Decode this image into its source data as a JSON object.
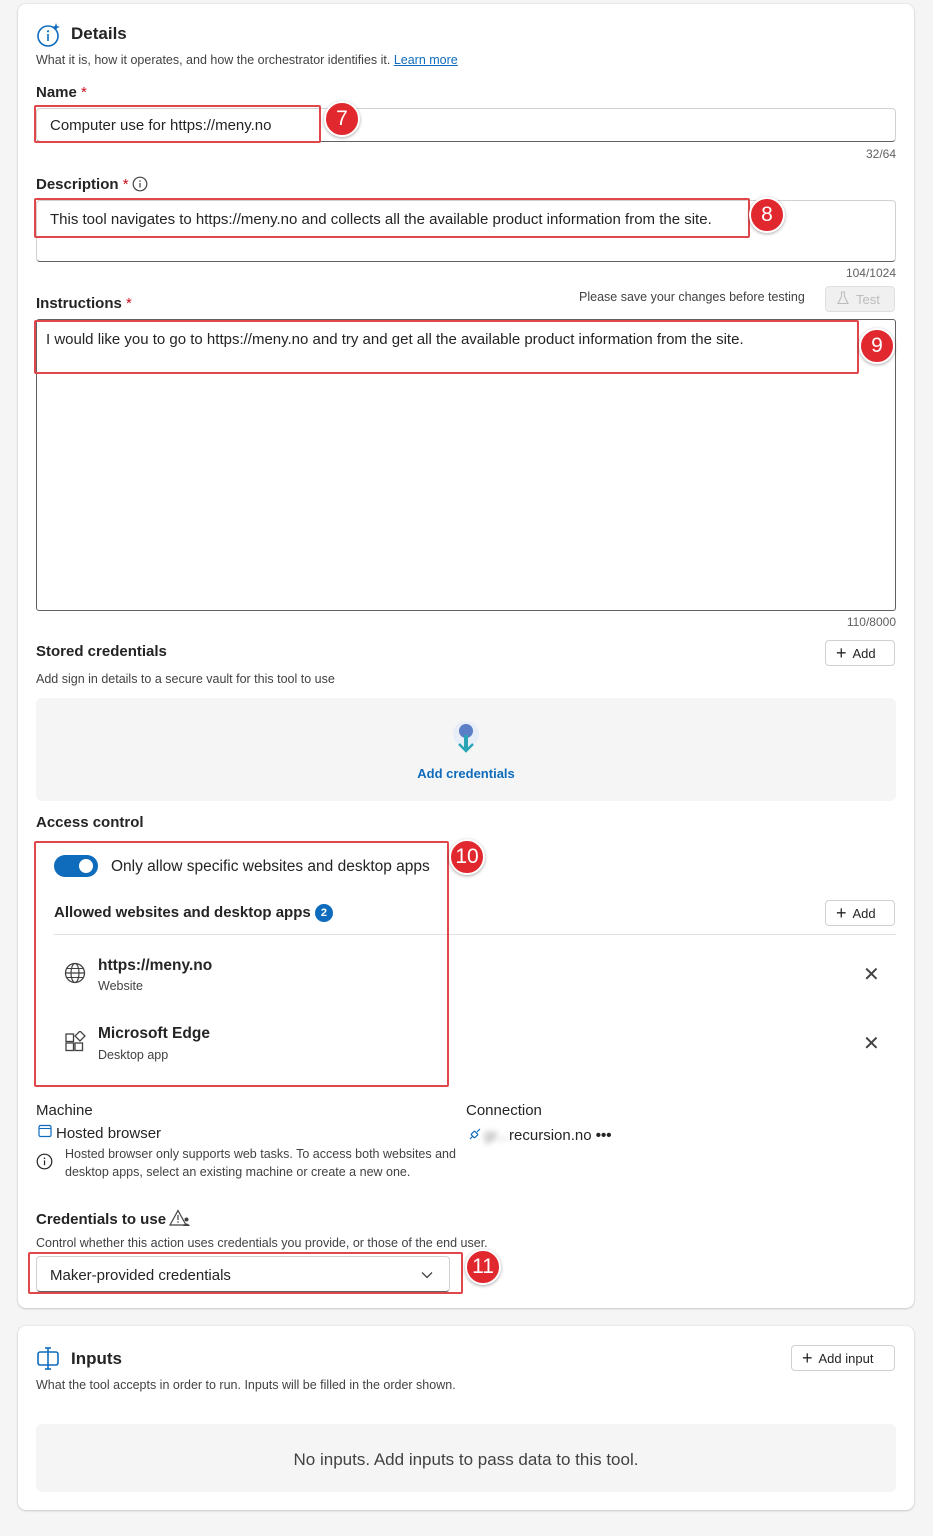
{
  "details": {
    "title": "Details",
    "subtitle": "What it is, how it operates, and how the orchestrator identifies it.",
    "learn_more": "Learn more",
    "name": {
      "label": "Name",
      "required": "*",
      "value": "Computer use for https://meny.no",
      "counter": "32/64"
    },
    "description": {
      "label": "Description",
      "required": "*",
      "value": "This tool navigates to https://meny.no and collects all the available product information from the site.",
      "counter": "104/1024"
    },
    "instructions": {
      "label": "Instructions",
      "required": "*",
      "save_notice": "Please save your changes before testing",
      "test_label": "Test",
      "value": "I would like you to go to https://meny.no and try and get all the available product information from the site.",
      "counter": "110/8000"
    },
    "stored_credentials": {
      "label": "Stored credentials",
      "description": "Add sign in details to a secure vault for this tool to use",
      "add_label": "Add",
      "empty_action": "Add credentials"
    },
    "access_control": {
      "label": "Access control",
      "toggle_label": "Only allow specific websites and desktop apps",
      "toggle_on": true,
      "allowed_title": "Allowed websites and desktop apps",
      "allowed_count": "2",
      "add_label": "Add",
      "items": [
        {
          "name": "https://meny.no",
          "type": "Website",
          "icon": "globe-icon"
        },
        {
          "name": "Microsoft Edge",
          "type": "Desktop app",
          "icon": "app-grid-icon"
        }
      ]
    },
    "machine": {
      "label": "Machine",
      "value": "Hosted browser",
      "note": "Hosted browser only supports web tasks. To access both websites and desktop apps, select an existing machine or create a new one."
    },
    "connection": {
      "label": "Connection",
      "value_hidden": "gr...",
      "value_suffix": "recursion.no",
      "more": "•••"
    },
    "credentials_to_use": {
      "label": "Credentials to use",
      "description": "Control whether this action uses credentials you provide, or those of the end user.",
      "selected": "Maker-provided credentials"
    },
    "callouts": [
      "7",
      "8",
      "9",
      "10",
      "11"
    ]
  },
  "inputs": {
    "title": "Inputs",
    "subtitle": "What the tool accepts in order to run. Inputs will be filled in the order shown.",
    "add_label": "Add input",
    "empty_text": "No inputs. Add inputs to pass data to this tool."
  },
  "colors": {
    "accent": "#0f6cbd",
    "callout": "#e0282e",
    "required": "#c50f1f"
  }
}
